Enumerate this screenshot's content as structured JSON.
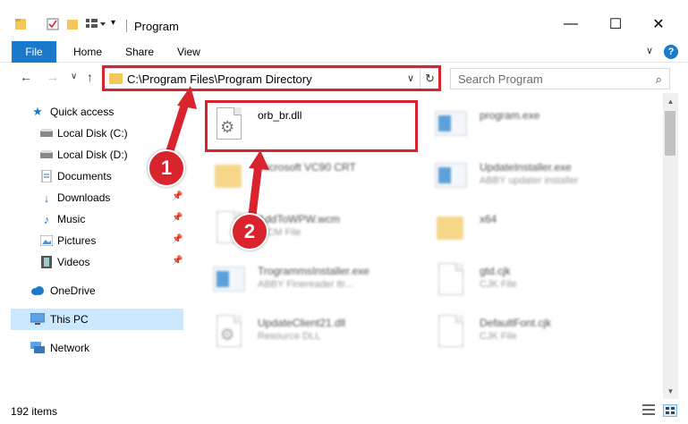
{
  "window": {
    "title": "Program",
    "minimize_glyph": "—",
    "maximize_glyph": "☐",
    "close_glyph": "✕"
  },
  "ribbon": {
    "file_label": "File",
    "tabs": [
      "Home",
      "Share",
      "View"
    ],
    "help_glyph": "?",
    "collapse_glyph": "∨"
  },
  "nav": {
    "back_glyph": "←",
    "forward_glyph": "→",
    "recent_glyph": "∨",
    "up_glyph": "↑",
    "address": "C:\\Program Files\\Program Directory",
    "dropdown_glyph": "∨",
    "refresh_glyph": "↻",
    "search_placeholder": "Search Program",
    "search_glyph": "⌕"
  },
  "sidebar": {
    "items": [
      {
        "label": "Quick access",
        "icon": "star-icon"
      },
      {
        "label": "Local Disk (C:)",
        "icon": "drive-icon"
      },
      {
        "label": "Local Disk (D:)",
        "icon": "drive-icon"
      },
      {
        "label": "Documents",
        "icon": "documents-icon"
      },
      {
        "label": "Downloads",
        "icon": "download-icon"
      },
      {
        "label": "Music",
        "icon": "music-icon"
      },
      {
        "label": "Pictures",
        "icon": "pictures-icon"
      },
      {
        "label": "Videos",
        "icon": "videos-icon"
      },
      {
        "label": "OneDrive",
        "icon": "cloud-icon"
      },
      {
        "label": "This PC",
        "icon": "computer-icon"
      },
      {
        "label": "Network",
        "icon": "network-icon"
      }
    ],
    "pin_glyph": "📌"
  },
  "files": [
    {
      "name": "orb_br.dll",
      "sub": "",
      "icon": "dll-icon"
    },
    {
      "name": "program.exe",
      "sub": "",
      "icon": "exe-icon"
    },
    {
      "name": "Microsoft VC90 CRT",
      "sub": "",
      "icon": "folder-icon"
    },
    {
      "name": "UpdateInstaller.exe",
      "sub": "ABBY updater installer",
      "icon": "exe-icon"
    },
    {
      "name": "AddToWPW.wcm",
      "sub": "WCM File",
      "icon": "file-icon"
    },
    {
      "name": "x64",
      "sub": "",
      "icon": "folder-icon"
    },
    {
      "name": "TrogrammsInstaller.exe",
      "sub": "ABBY Finereader ttr...",
      "icon": "exe-icon"
    },
    {
      "name": "gtd.cjk",
      "sub": "CJK File",
      "icon": "file-icon"
    },
    {
      "name": "UpdateClient21.dll",
      "sub": "Resource DLL",
      "icon": "dll-icon"
    },
    {
      "name": "DefaultFont.cjk",
      "sub": "CJK File",
      "icon": "file-icon"
    }
  ],
  "status": {
    "item_count": "192 items"
  },
  "callouts": {
    "step1": "1",
    "step2": "2"
  },
  "colors": {
    "accent": "#1979ca",
    "highlight": "#d9232d",
    "selected": "#cce8ff",
    "folder": "#f3c75a"
  }
}
